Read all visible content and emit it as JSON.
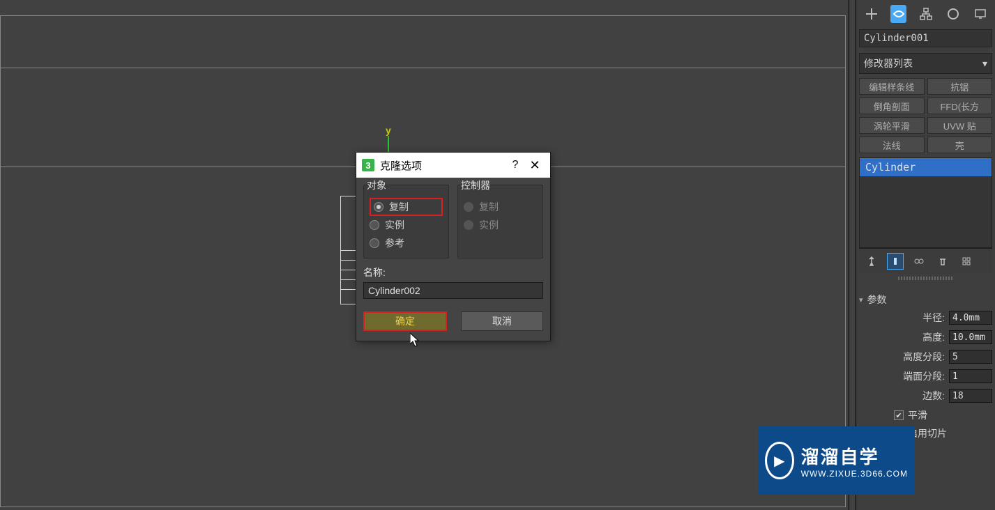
{
  "viewport": {
    "y_label": "y"
  },
  "dialog": {
    "app_icon_text": "3",
    "title": "克隆选项",
    "help_glyph": "?",
    "close_glyph": "✕",
    "object_group_label": "对象",
    "controller_group_label": "控制器",
    "radios": {
      "copy": "复制",
      "instance": "实例",
      "reference": "参考"
    },
    "controller_radios": {
      "copy": "复制",
      "instance": "实例"
    },
    "name_label": "名称:",
    "name_value": "Cylinder002",
    "ok": "确定",
    "cancel": "取消"
  },
  "panel": {
    "object_name": "Cylinder001",
    "modifier_list_label": "修改器列表",
    "mod_buttons": [
      "编辑样条线",
      "抗锯",
      "倒角剖面",
      "FFD(长方",
      "涡轮平滑",
      "UVW 贴",
      "法线",
      "壳"
    ],
    "stack_item": "Cylinder",
    "rollout_title": "参数",
    "params": [
      {
        "label": "半径:",
        "value": "4.0mm"
      },
      {
        "label": "高度:",
        "value": "10.0mm"
      },
      {
        "label": "高度分段:",
        "value": "5"
      },
      {
        "label": "端面分段:",
        "value": "1"
      },
      {
        "label": "边数:",
        "value": "18"
      }
    ],
    "smooth_label": "平滑",
    "slice_label": "启用切片"
  },
  "watermark": {
    "play_glyph": "▶",
    "big": "溜溜自学",
    "small": "WWW.ZIXUE.3D66.COM"
  }
}
